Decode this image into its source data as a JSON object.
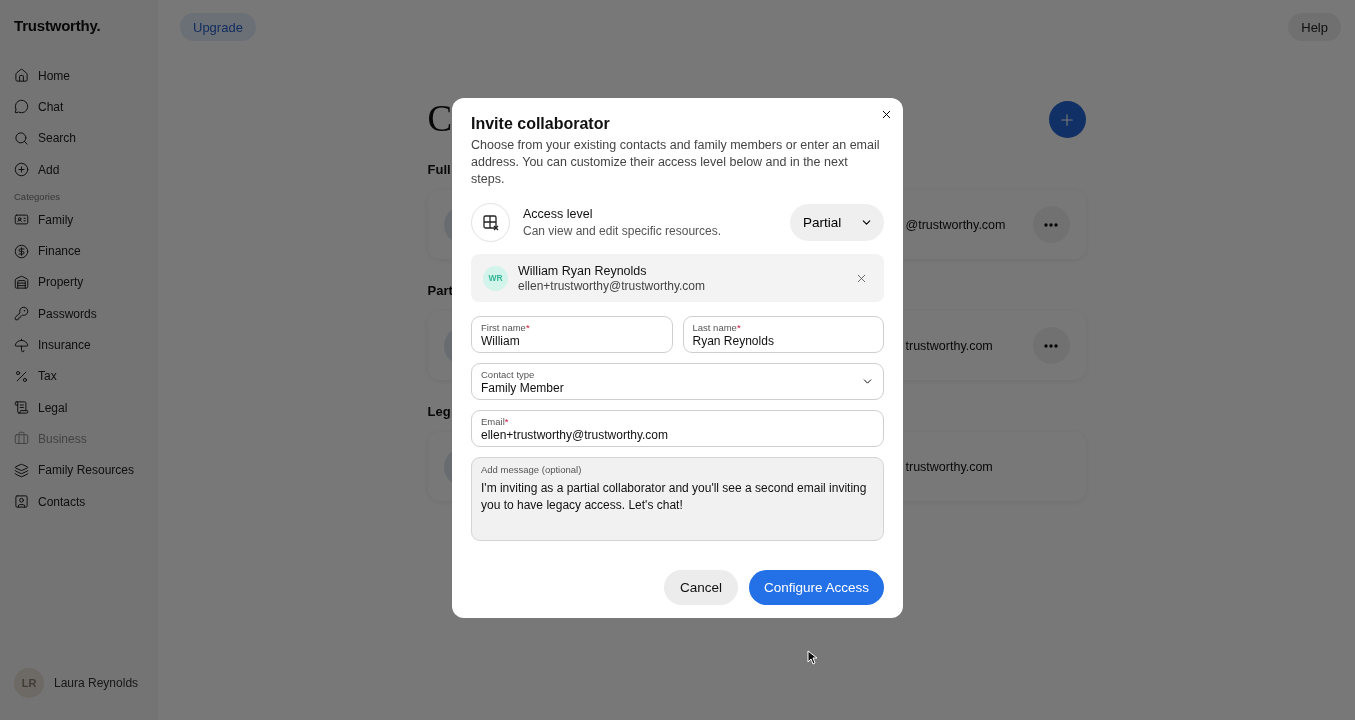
{
  "sidebar": {
    "logo": "Trustworthy.",
    "nav": [
      {
        "label": "Home",
        "disabled": false
      },
      {
        "label": "Chat",
        "disabled": false
      },
      {
        "label": "Search",
        "disabled": false
      },
      {
        "label": "Add",
        "disabled": false
      }
    ],
    "categories_label": "Categories",
    "categories": [
      {
        "label": "Family",
        "disabled": false
      },
      {
        "label": "Finance",
        "disabled": false
      },
      {
        "label": "Property",
        "disabled": false
      },
      {
        "label": "Passwords",
        "disabled": false
      },
      {
        "label": "Insurance",
        "disabled": false
      },
      {
        "label": "Tax",
        "disabled": false
      },
      {
        "label": "Legal",
        "disabled": false
      },
      {
        "label": "Business",
        "disabled": true
      },
      {
        "label": "Family Resources",
        "disabled": false
      },
      {
        "label": "Contacts",
        "disabled": false
      }
    ],
    "user": {
      "initials": "LR",
      "name": "Laura Reynolds"
    }
  },
  "topbar": {
    "upgrade": "Upgrade",
    "help": "Help"
  },
  "page": {
    "heading": "C",
    "sections": [
      {
        "title": "Full",
        "cards": [
          {
            "email": "@trustworthy.com",
            "menu": true
          }
        ]
      },
      {
        "title": "Part",
        "cards": [
          {
            "email": "trustworthy.com",
            "menu": true
          }
        ]
      },
      {
        "title": "Leg",
        "cards": [
          {
            "email": "trustworthy.com",
            "menu": false
          }
        ]
      }
    ]
  },
  "modal": {
    "title": "Invite collaborator",
    "description": "Choose from your existing contacts and family members or enter an email address. You can customize their access level below and in the next steps.",
    "access": {
      "label": "Access level",
      "description": "Can view and edit specific resources.",
      "value": "Partial"
    },
    "contact": {
      "initials": "WR",
      "name": "William Ryan Reynolds",
      "email": "ellen+trustworthy@trustworthy.com"
    },
    "required_mark": "*",
    "fields": [
      {
        "kind": "text",
        "label": "First name",
        "required": true,
        "value": "William"
      },
      {
        "kind": "text",
        "label": "Last name",
        "required": true,
        "value": "Ryan Reynolds"
      },
      {
        "kind": "select",
        "label": "Contact type",
        "required": false,
        "value": "Family Member"
      },
      {
        "kind": "text",
        "label": "Email",
        "required": true,
        "value": "ellen+trustworthy@trustworthy.com"
      }
    ],
    "message": {
      "label": "Add message (optional)",
      "value": "I'm inviting as a partial collaborator and you'll see a second email inviting you to have legacy access. Let's chat!"
    },
    "buttons": {
      "cancel": "Cancel",
      "confirm": "Configure Access"
    }
  }
}
